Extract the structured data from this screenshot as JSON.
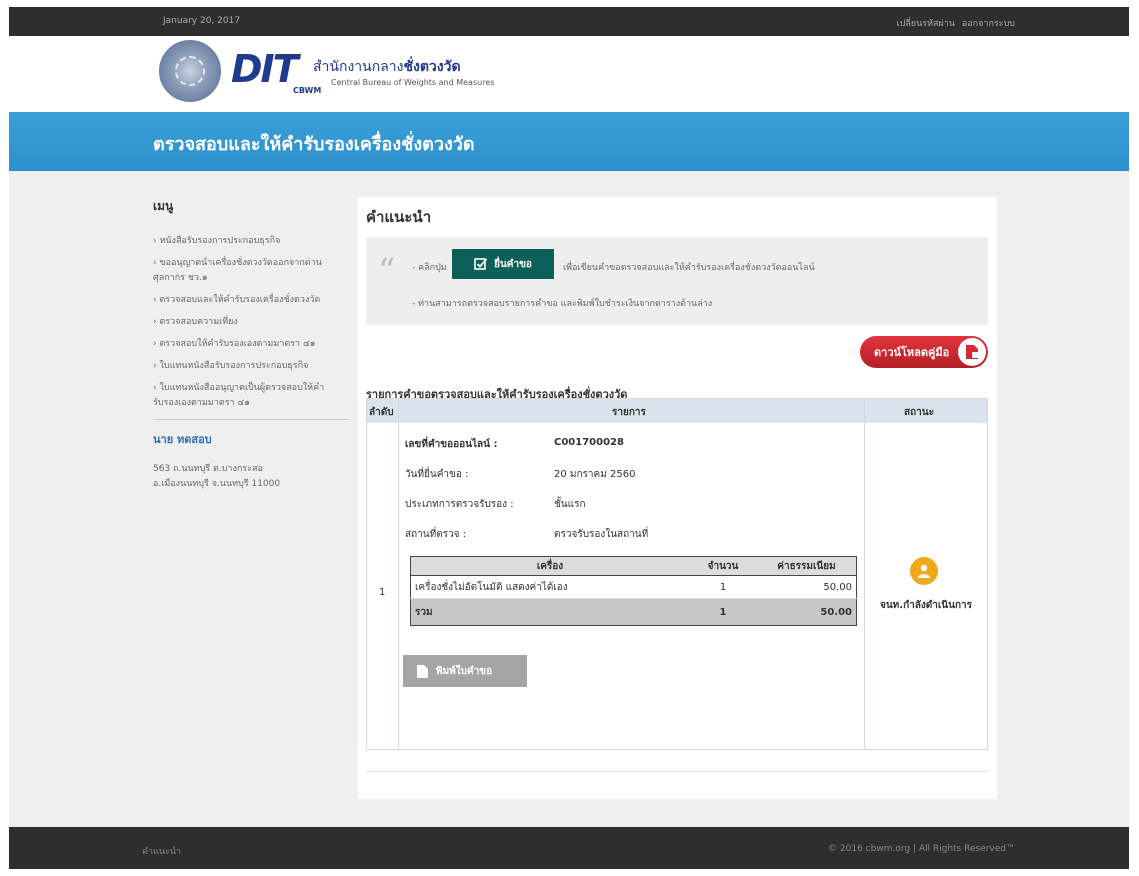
{
  "topbar": {
    "date": "January 20, 2017",
    "change_password": "เปลี่ยนรหัสผ่าน",
    "logout": "ออกจากระบบ"
  },
  "header": {
    "logo_text": "DIT",
    "logo_sub": "CBWM",
    "org_thai_prefix": "สำนักงานกลาง",
    "org_thai_bold": "ชั่งตวงวัด",
    "org_en": "Central Bureau of Weights and Measures"
  },
  "banner": {
    "title": "ตรวจสอบและให้คำรับรองเครื่องชั่งตวงวัด"
  },
  "sidebar": {
    "menu_head": "เมนู",
    "items": [
      "› หนังสือรับรองการประกอบธุรกิจ",
      "› ขออนุญาตนำเครื่องชั่งตวงวัดออกจากด่านศุลกากร ชว.๑",
      "› ตรวจสอบและให้คำรับรองเครื่องชั่งตวงวัด",
      "› ตรวจสอบความเที่ยง",
      "› ตรวจสอบให้คำรับรองเองตามมาตรา ๔๑",
      "› ใบแทนหนังสือรับรองการประกอบธุรกิจ",
      "› ใบแทนหนังสืออนุญาตเป็นผู้ตรวจสอบให้คำรับรองเองตามมาตรา ๔๑"
    ],
    "user_name": "นาย ทดสอบ",
    "address_line1": "563 ถ.นนทบุรี ต.บางกระสอ",
    "address_line2": "อ.เมืองนนทบุรี จ.นนทบุรี 11000"
  },
  "content": {
    "heading": "คำแนะนำ",
    "notice": {
      "prefix": "- คลิกปุ่ม",
      "submit_label": "ยื่นคำขอ",
      "suffix": "เพื่อเขียนคำขอตรวจสอบและให้คำรับรองเครื่องชั่งตวงวัดออนไลน์",
      "line2": "- ท่านสามารถตรวจสอบรายการคำขอ และพิมพ์ใบชำระเงินจากตารางด้านล่าง"
    },
    "download_label": "ดาวน์โหลดคู่มือ",
    "list_title": "รายการคำขอตรวจสอบและให้คำรับรองเครื่องชั่งตวงวัด",
    "columns": [
      "ลำดับ",
      "รายการ",
      "สถานะ"
    ],
    "row": {
      "index": "1",
      "request_no_label": "เลขที่คำขอออนไลน์ :",
      "request_no": "C001700028",
      "date_label": "วันที่ยื่นคำขอ :",
      "date": "20 มกราคม 2560",
      "type_label": "ประเภทการตรวจรับรอง :",
      "type": "ชั้นแรก",
      "place_label": "สถานที่ตรวจ :",
      "place": "ตรวจรับรองในสถานที่",
      "items_table": {
        "headers": [
          "เครื่อง",
          "จำนวน",
          "ค่าธรรมเนียม"
        ],
        "rows": [
          {
            "name": "เครื่องชั่งไม่อัตโนมัติ แสดงค่าได้เอง",
            "qty": "1",
            "fee": "50.00"
          }
        ],
        "total_label": "รวม",
        "total_qty": "1",
        "total_fee": "50.00"
      },
      "print_label": "พิมพ์ใบคำขอ",
      "status": "จนท.กำลังดำเนินการ"
    }
  },
  "footer": {
    "left": "คำแนะนำ",
    "right": "© 2016 cbwm.org | All Rights Reserved™"
  },
  "colors": {
    "banner": "#3aa0d8",
    "submit_button": "#0d5f59",
    "download_button": "#d42a32",
    "status_icon": "#f1a91c",
    "print_button": "#a5a5a5",
    "dark_bar": "#2e2e2e"
  }
}
